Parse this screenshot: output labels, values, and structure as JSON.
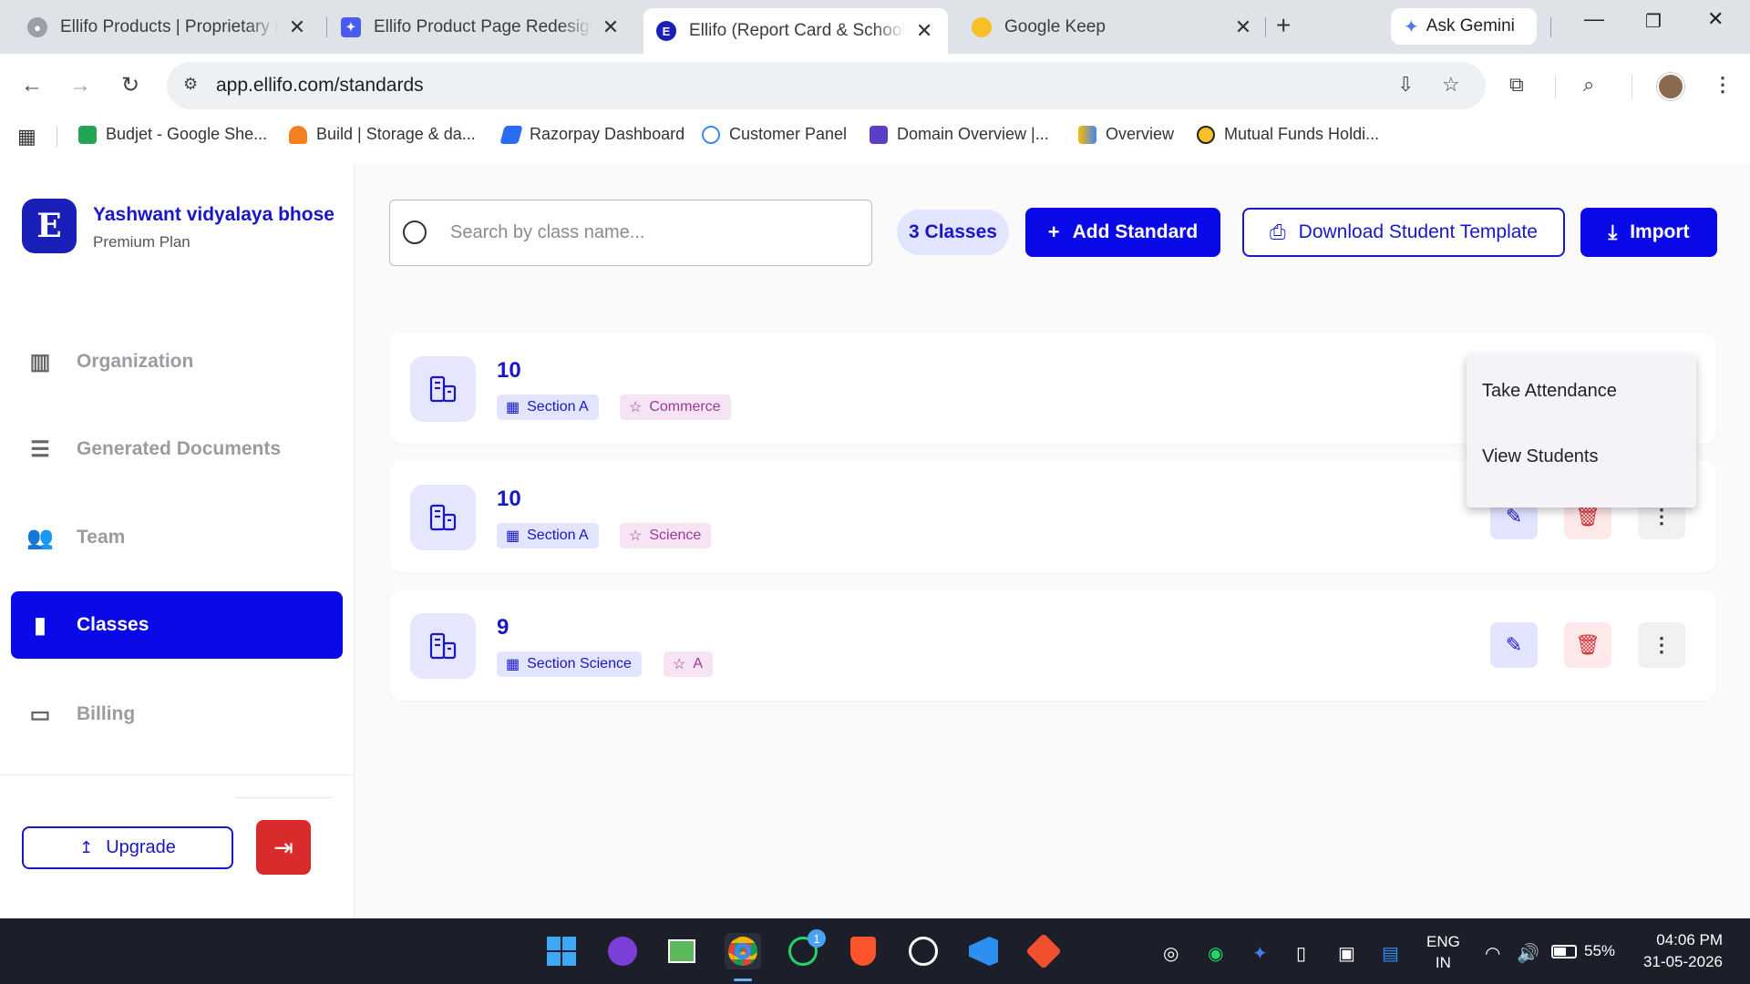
{
  "browser": {
    "tabs": [
      {
        "title": "Ellifo Products | Proprietary Engineering"
      },
      {
        "title": "Ellifo Product Page Redesign - Figma"
      },
      {
        "title": "Ellifo (Report Card & School ERP)"
      },
      {
        "title": "Google Keep"
      }
    ],
    "ask_gemini": "Ask Gemini",
    "url": "app.ellifo.com/standards",
    "bookmarks": [
      "Budjet - Google She...",
      "Build | Storage & da...",
      "Razorpay Dashboard",
      "Customer Panel",
      "Domain Overview |...",
      "Overview",
      "Mutual Funds Holdi..."
    ]
  },
  "sidebar": {
    "logo_letter": "E",
    "org_name": "Yashwant vidyalaya bhose",
    "plan": "Premium Plan",
    "items": [
      {
        "label": "Organization",
        "icon": "building-icon"
      },
      {
        "label": "Generated Documents",
        "icon": "documents-list-icon"
      },
      {
        "label": "Team",
        "icon": "team-icon"
      },
      {
        "label": "Classes",
        "icon": "book-icon",
        "active": true
      },
      {
        "label": "Billing",
        "icon": "credit-card-icon"
      }
    ],
    "upgrade_label": "Upgrade"
  },
  "main": {
    "search_placeholder": "Search by class name...",
    "count_label": "3 Classes",
    "add_label": "Add Standard",
    "download_label": "Download Student Template",
    "import_label": "Import",
    "classes": [
      {
        "name": "10",
        "section": "Section A",
        "stream": "Commerce"
      },
      {
        "name": "10",
        "section": "Section A",
        "stream": "Science"
      },
      {
        "name": "9",
        "section": "Section Science",
        "stream": "A"
      }
    ],
    "menu": {
      "take_attendance": "Take Attendance",
      "view_students": "View Students"
    }
  },
  "taskbar": {
    "lang_top": "ENG",
    "lang_bottom": "IN",
    "battery": "55%",
    "time": "04:06 PM",
    "date": "31-05-2026",
    "whatsapp_badge": "1"
  }
}
